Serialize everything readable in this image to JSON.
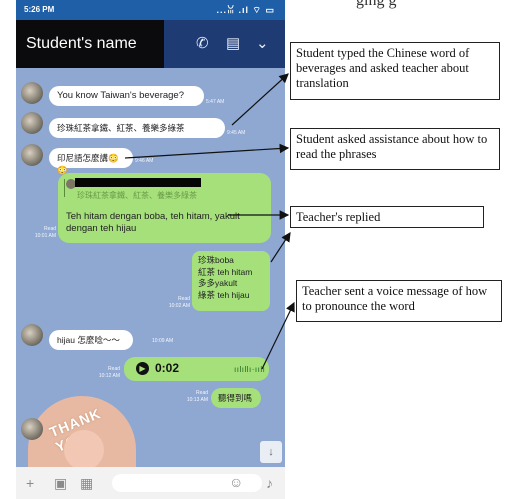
{
  "figure_caption": "ging g",
  "status_bar": {
    "time": "5:26 PM",
    "icons": "...ꈍ .ıl ⌔ ▭"
  },
  "header": {
    "title": "Student's name",
    "call_icon": "phone-icon",
    "notes_icon": "notes-icon",
    "menu_icon": "chevron-down-icon"
  },
  "messages": {
    "m1": {
      "text": "You know Taiwan's beverage?",
      "time": "5:47 AM"
    },
    "m2": {
      "text": "珍珠紅茶拿鐵、紅茶、養樂多綠茶",
      "time": "9:45 AM"
    },
    "m3": {
      "text": "印尼語怎麼講😳😳",
      "time": "9:46 AM"
    },
    "m4": {
      "quote": "珍珠紅茶拿鐵、紅茶、養樂多綠茶",
      "text": "Teh hitam dengan boba, teh hitam, yakult dengan teh hijau",
      "read": "Read",
      "time": "10:01 AM"
    },
    "m5": {
      "lines": [
        "珍珠boba",
        "紅茶 teh hitam",
        "多多yakult",
        "綠茶 teh hijau"
      ],
      "read": "Read",
      "time": "10:02 AM"
    },
    "m6": {
      "text": "hijau 怎麼唸～～",
      "time": "10:09 AM"
    },
    "m7": {
      "duration": "0:02",
      "wave": "ıılıllı·ıılı",
      "read": "Read",
      "time": "10:12 AM"
    },
    "m8": {
      "text": "聽得到嗎",
      "read": "Read",
      "time": "10:13 AM"
    }
  },
  "sticker_text": "THANK YOU",
  "input_bar": {
    "plus_icon": "plus-icon",
    "camera_icon": "camera-icon",
    "image_icon": "image-icon",
    "emoji_icon": "emoji-icon",
    "mic_icon": "mic-icon"
  },
  "callouts": [
    "Student typed the Chinese word of beverages and asked teacher about translation",
    "Student asked assistance about how to read the phrases",
    "Teacher's replied",
    "Teacher sent a voice message of how to pronounce the word"
  ]
}
